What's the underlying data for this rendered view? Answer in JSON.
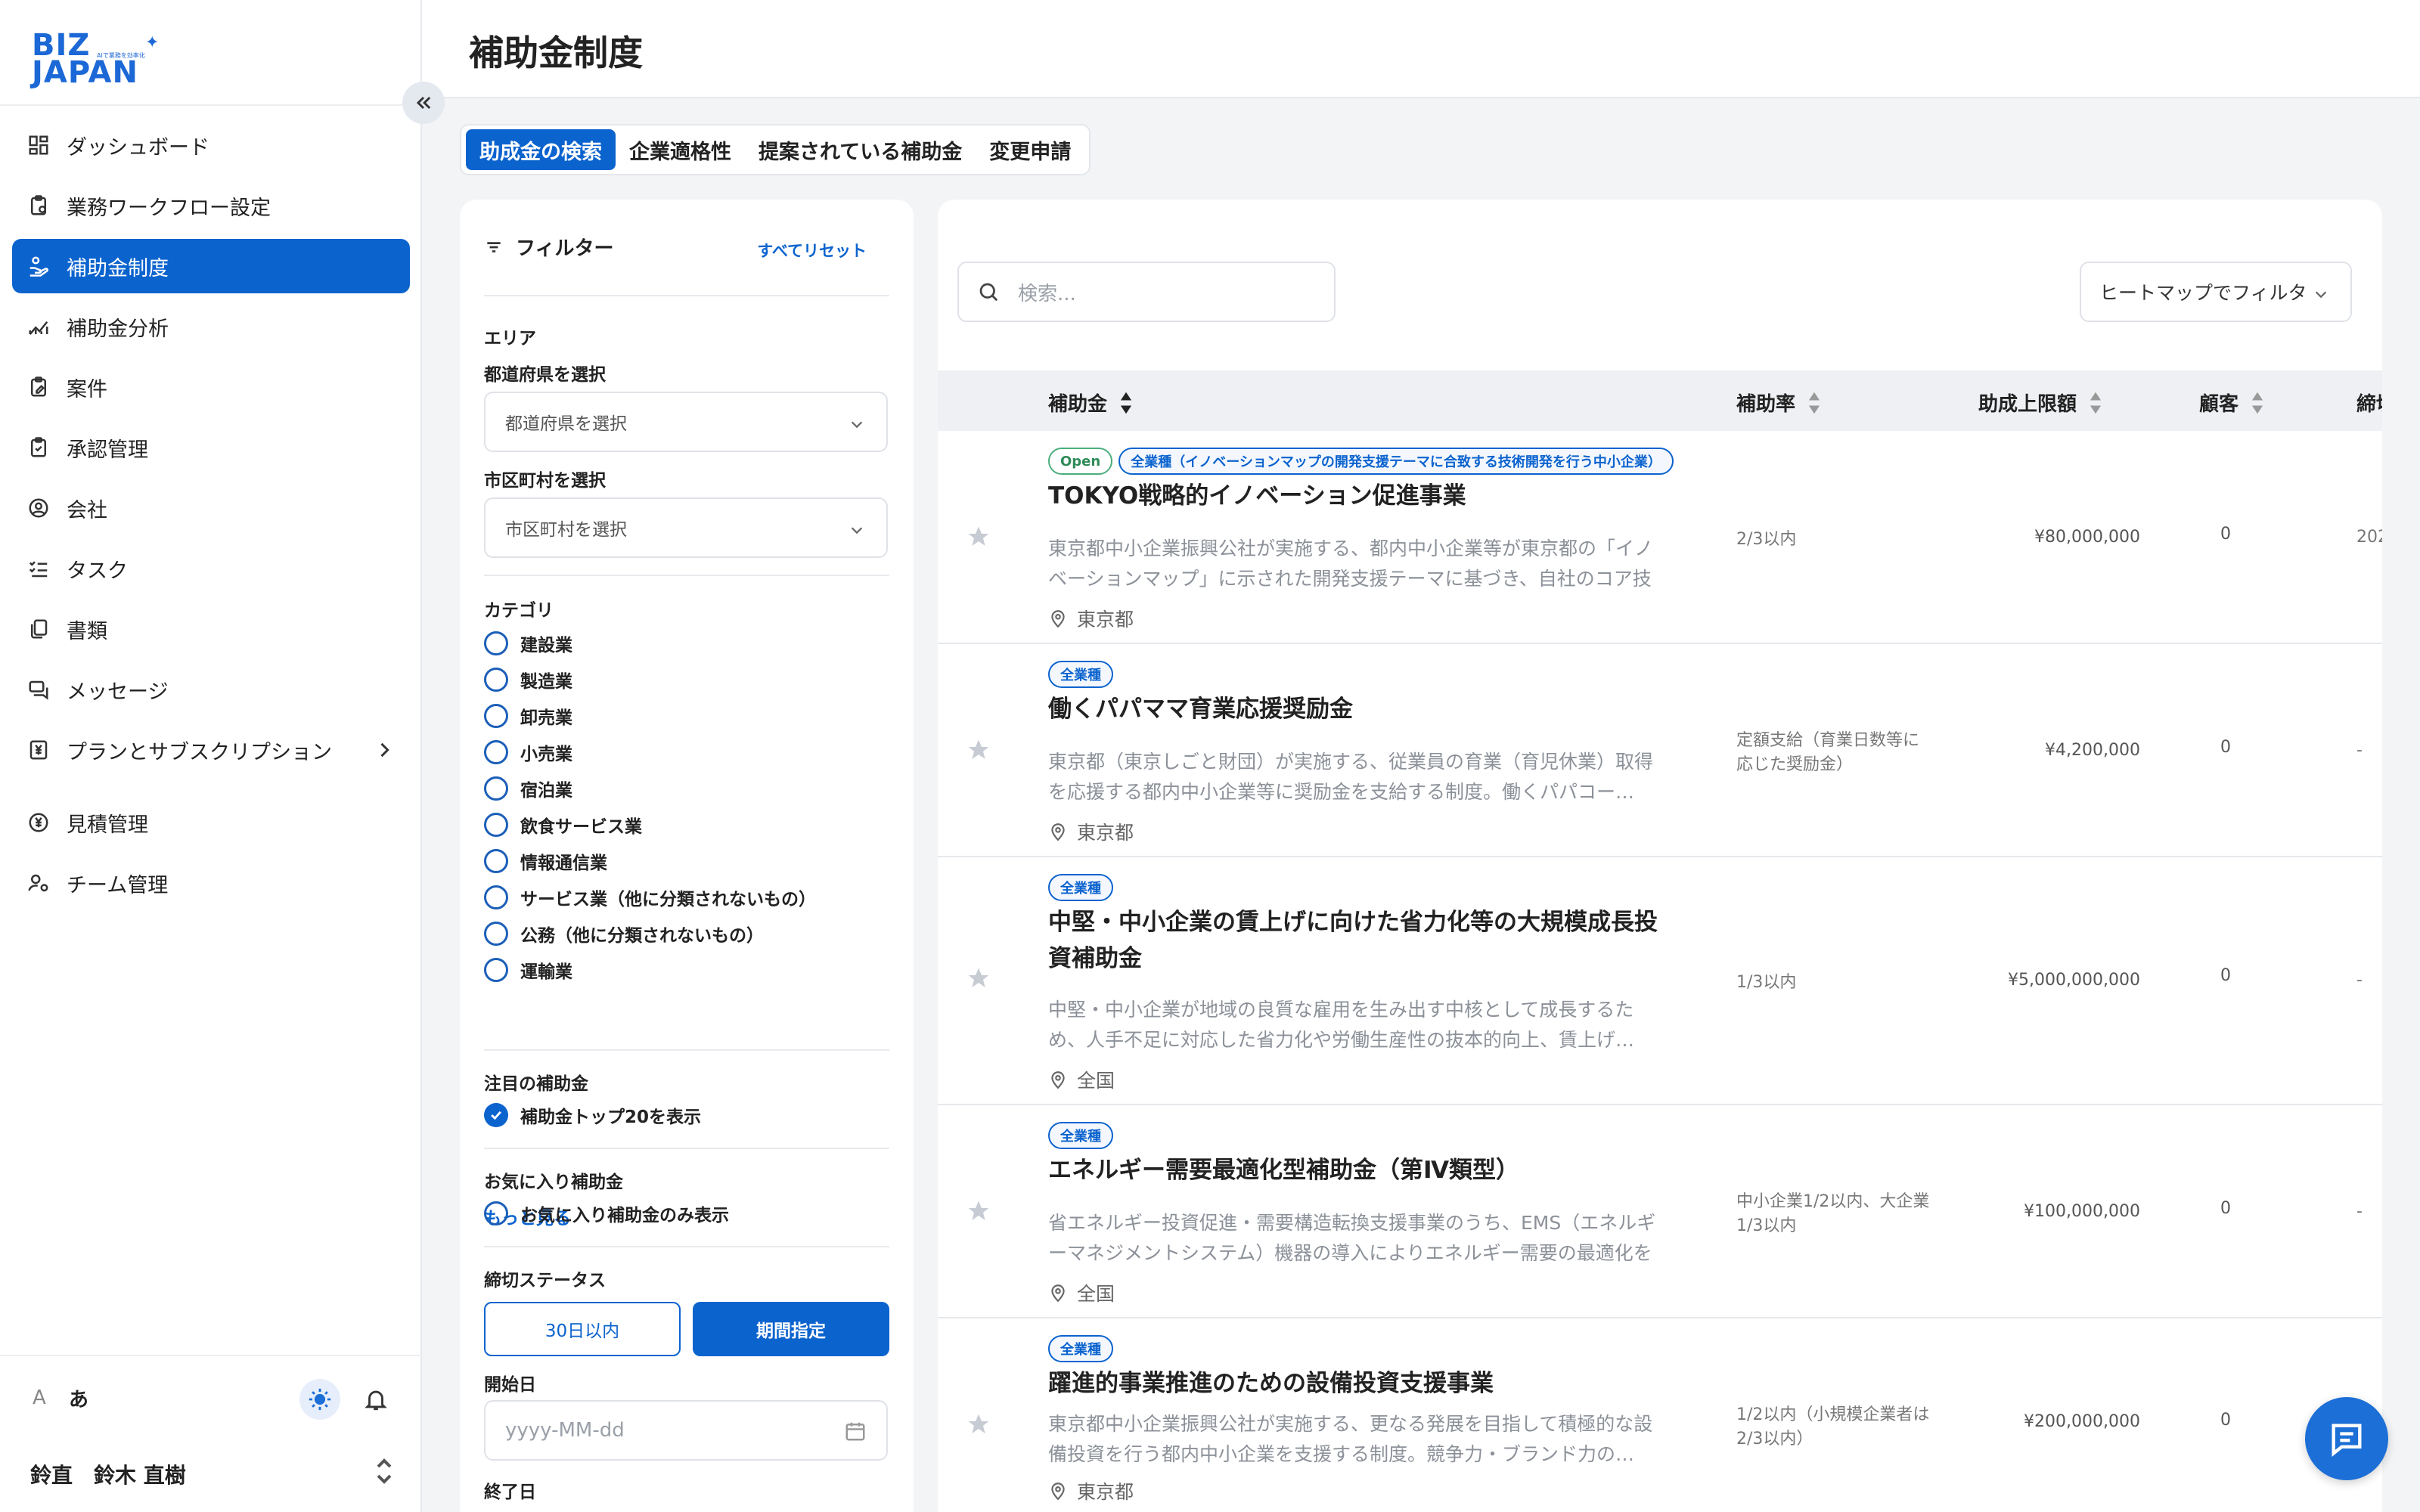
{
  "app": {
    "brand_line1": "BIZ",
    "brand_line2": "JAPAN",
    "brand_tagline": "AIで業務を効率化"
  },
  "sidebar": {
    "items": [
      {
        "label": "ダッシュボード",
        "icon": "dashboard-icon"
      },
      {
        "label": "業務ワークフロー設定",
        "icon": "clipboard-gear-icon"
      },
      {
        "label": "補助金制度",
        "icon": "hand-coin-icon",
        "active": true
      },
      {
        "label": "補助金分析",
        "icon": "chart-line-icon"
      },
      {
        "label": "案件",
        "icon": "clipboard-edit-icon"
      },
      {
        "label": "承認管理",
        "icon": "clipboard-check-icon"
      },
      {
        "label": "会社",
        "icon": "user-circle-icon"
      },
      {
        "label": "タスク",
        "icon": "list-check-icon"
      },
      {
        "label": "書類",
        "icon": "documents-icon"
      },
      {
        "label": "メッセージ",
        "icon": "chat-icon"
      },
      {
        "label": "プランとサブスクリプション",
        "icon": "yen-receipt-icon"
      },
      {
        "label": "見積管理",
        "icon": "yen-circle-icon"
      },
      {
        "label": "チーム管理",
        "icon": "team-settings-icon"
      }
    ],
    "lang_a": "A",
    "lang_ja": "あ",
    "user_short": "鈴直",
    "user_name": "鈴木 直樹"
  },
  "header": {
    "title": "補助金制度"
  },
  "tabs": [
    {
      "label": "助成金の検索",
      "active": true
    },
    {
      "label": "企業適格性"
    },
    {
      "label": "提案されている補助金"
    },
    {
      "label": "変更申請"
    }
  ],
  "filter": {
    "title": "フィルター",
    "reset": "すべてリセット",
    "area_label": "エリア",
    "pref_label": "都道府県を選択",
    "pref_placeholder": "都道府県を選択",
    "city_label": "市区町村を選択",
    "city_placeholder": "市区町村を選択",
    "category_label": "カテゴリ",
    "categories": [
      "建設業",
      "製造業",
      "卸売業",
      "小売業",
      "宿泊業",
      "飲食サービス業",
      "情報通信業",
      "サービス業（他に分類されないもの）",
      "公務（他に分類されないもの）",
      "運輸業"
    ],
    "more": "もっと見る",
    "featured_label": "注目の補助金",
    "featured_option": "補助金トップ20を表示",
    "fav_label": "お気に入り補助金",
    "fav_option": "お気に入り補助金のみ表示",
    "deadline_label": "締切ステータス",
    "btn_30": "30日以内",
    "btn_period": "期間指定",
    "start_label": "開始日",
    "start_placeholder": "yyyy-MM-dd",
    "end_label": "終了日"
  },
  "results": {
    "search_placeholder": "検索...",
    "heatmap_label": "ヒートマップでフィルタ",
    "columns": [
      "補助金",
      "補助率",
      "助成上限額",
      "顧客",
      "締切"
    ],
    "rows": [
      {
        "badges": [
          "Open",
          "全業種（イノベーションマップの開発支援テーマに合致する技術開発を行う中小企業）"
        ],
        "title": "TOKYO戦略的イノベーション促進事業",
        "desc": "東京都中小企業振興公社が実施する、都内中小企業等が東京都の「イノベーションマップ」に示された開発支援テーマに基づき、自社のコア技術…",
        "location": "東京都",
        "rate": "2/3以内",
        "amount": "¥80,000,000",
        "customers": "0",
        "deadline": "202"
      },
      {
        "badges": [
          "全業種"
        ],
        "title": "働くパパママ育業応援奨励金",
        "desc": "東京都（東京しごと財団）が実施する、従業員の育業（育児休業）取得を応援する都内中小企業等に奨励金を支給する制度。働くパパコー…",
        "location": "東京都",
        "rate": "定額支給（育業日数等に応じた奨励金）",
        "amount": "¥4,200,000",
        "customers": "0",
        "deadline": "-"
      },
      {
        "badges": [
          "全業種"
        ],
        "title": "中堅・中小企業の賃上げに向けた省力化等の大規模成長投資補助金",
        "desc": "中堅・中小企業が地域の良質な雇用を生み出す中核として成長するため、人手不足に対応した省力化や労働生産性の抜本的向上、賃上げ…",
        "location": "全国",
        "rate": "1/3以内",
        "amount": "¥5,000,000,000",
        "customers": "0",
        "deadline": "-"
      },
      {
        "badges": [
          "全業種"
        ],
        "title": "エネルギー需要最適化型補助金（第Ⅳ類型）",
        "desc": "省エネルギー投資促進・需要構造転換支援事業のうち、EMS（エネルギーマネジメントシステム）機器の導入によりエネルギー需要の最適化を図…",
        "location": "全国",
        "rate": "中小企業1/2以内、大企業1/3以内",
        "amount": "¥100,000,000",
        "customers": "0",
        "deadline": "-"
      },
      {
        "badges": [
          "全業種"
        ],
        "title": "躍進的事業推進のための設備投資支援事業",
        "desc": "東京都中小企業振興公社が実施する、更なる発展を目指して積極的な設備投資を行う都内中小企業を支援する制度。競争力・ブランド力の…",
        "location": "東京都",
        "rate": "1/2以内（小規模企業者は2/3以内）",
        "amount": "¥200,000,000",
        "customers": "0",
        "deadline": ""
      }
    ]
  },
  "colors": {
    "primary": "#0b63ce",
    "open_badge": "#2e8b57",
    "muted": "#8c9199"
  }
}
